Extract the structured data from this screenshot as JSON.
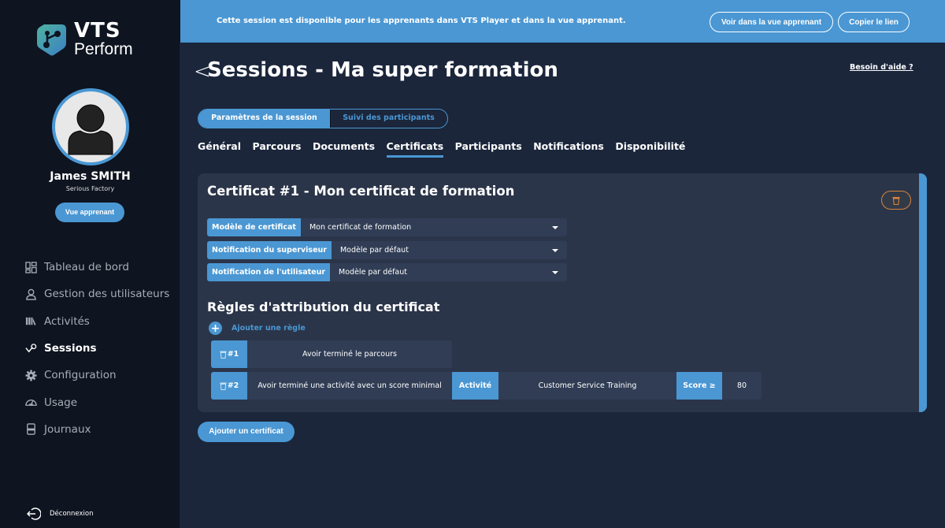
{
  "brand": {
    "name_top": "VTS",
    "name_bottom": "Perform"
  },
  "user": {
    "name": "James SMITH",
    "organization": "Serious Factory",
    "learner_view_label": "Vue apprenant"
  },
  "nav": {
    "items": [
      {
        "label": "Tableau de bord",
        "icon": "dashboard-icon",
        "active": false
      },
      {
        "label": "Gestion des utilisateurs",
        "icon": "user-icon",
        "active": false
      },
      {
        "label": "Activités",
        "icon": "books-icon",
        "active": false
      },
      {
        "label": "Sessions",
        "icon": "sessions-icon",
        "active": true
      },
      {
        "label": "Configuration",
        "icon": "gear-icon",
        "active": false
      },
      {
        "label": "Usage",
        "icon": "gauge-icon",
        "active": false
      },
      {
        "label": "Journaux",
        "icon": "log-icon",
        "active": false
      }
    ],
    "logout_label": "Déconnexion"
  },
  "banner": {
    "text": "Cette session est disponible pour les apprenants dans VTS Player et dans la vue apprenant.",
    "view_button": "Voir dans la vue apprenant",
    "copy_button": "Copier le lien"
  },
  "header": {
    "title": "Sessions - Ma super formation",
    "back_symbol": "<",
    "help_link": "Besoin d'aide ?"
  },
  "segmented": {
    "options": [
      "Paramètres de la session",
      "Suivi des participants"
    ],
    "selected": 0
  },
  "tabs": {
    "items": [
      "Général",
      "Parcours",
      "Documents",
      "Certificats",
      "Participants",
      "Notifications",
      "Disponibilité"
    ],
    "active": "Certificats"
  },
  "certificate": {
    "title": "Certificat #1 - Mon certificat de formation",
    "fields": [
      {
        "label": "Modèle de certificat",
        "value": "Mon certificat de formation"
      },
      {
        "label": "Notification du superviseur",
        "value": "Modèle par défaut"
      },
      {
        "label": "Notification de l'utilisateur",
        "value": "Modèle par défaut"
      }
    ],
    "rules_title": "Règles d'attribution du certificat",
    "add_rule_label": "Ajouter une règle",
    "rules": [
      {
        "number": "#1",
        "text": "Avoir terminé le parcours"
      },
      {
        "number": "#2",
        "text": "Avoir terminé une activité avec un score minimal",
        "activity_label": "Activité",
        "activity_value": "Customer Service Training",
        "score_label": "Score ≥",
        "score_value": "80"
      }
    ]
  },
  "add_certificate_label": "Ajouter un certificat",
  "colors": {
    "accent": "#4a97d3",
    "sidebar_bg": "#0e1420",
    "main_bg": "#1b263b",
    "card_bg": "#2b3549",
    "danger": "#d9843c"
  }
}
